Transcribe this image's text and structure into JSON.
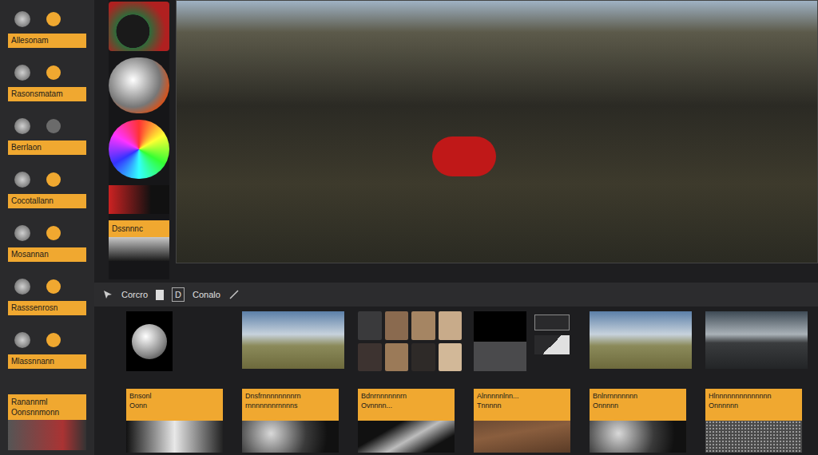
{
  "layers_panel": {
    "items": [
      {
        "label": "Allesonam",
        "dot_color": "#f0a830"
      },
      {
        "label": "Rasonsmatam",
        "dot_color": "#f0a830"
      },
      {
        "label": "Berrlaon",
        "dot_color": "#6b6b6b"
      },
      {
        "label": "Cocotallann",
        "dot_color": "#f0a830"
      },
      {
        "label": "Mosannan",
        "dot_color": "#f0a830"
      },
      {
        "label": "Rasssenrosn",
        "dot_color": "#f0a830"
      },
      {
        "label": "Mlassnnann",
        "dot_color": "#f0a830"
      }
    ],
    "footer_label": "Ranannml Oonsnnmonn"
  },
  "swatch_panel": {
    "label": "Dssnnnc"
  },
  "toolbar": {
    "items": [
      "Corcro",
      "D",
      "Conalo"
    ]
  },
  "thumbnails": [
    {
      "kind": "sphere"
    },
    {
      "kind": "landscape"
    },
    {
      "kind": "palette"
    },
    {
      "kind": "swatch"
    },
    {
      "kind": "landscape"
    },
    {
      "kind": "water"
    }
  ],
  "cards": [
    {
      "title": "Bnsonl",
      "subtitle": "Oonn",
      "kind": "sphere"
    },
    {
      "title": "Dnsfrnnnnnnnnrn",
      "subtitle": "rnnnnnnnrnnnns",
      "kind": "orb"
    },
    {
      "title": "Bdnrnnnnnnrn",
      "subtitle": "Ovnnnn...",
      "kind": "dark"
    },
    {
      "title": "Alnnnnnlnn...",
      "subtitle": "Tnnnnn",
      "kind": "wood"
    },
    {
      "title": "Bnlnrnnnnnnn",
      "subtitle": "Onnnnn",
      "kind": "orb"
    },
    {
      "title": "Hlnnnnnnnnnnnnnn",
      "subtitle": "Onnnnnn",
      "kind": "gravel"
    }
  ]
}
